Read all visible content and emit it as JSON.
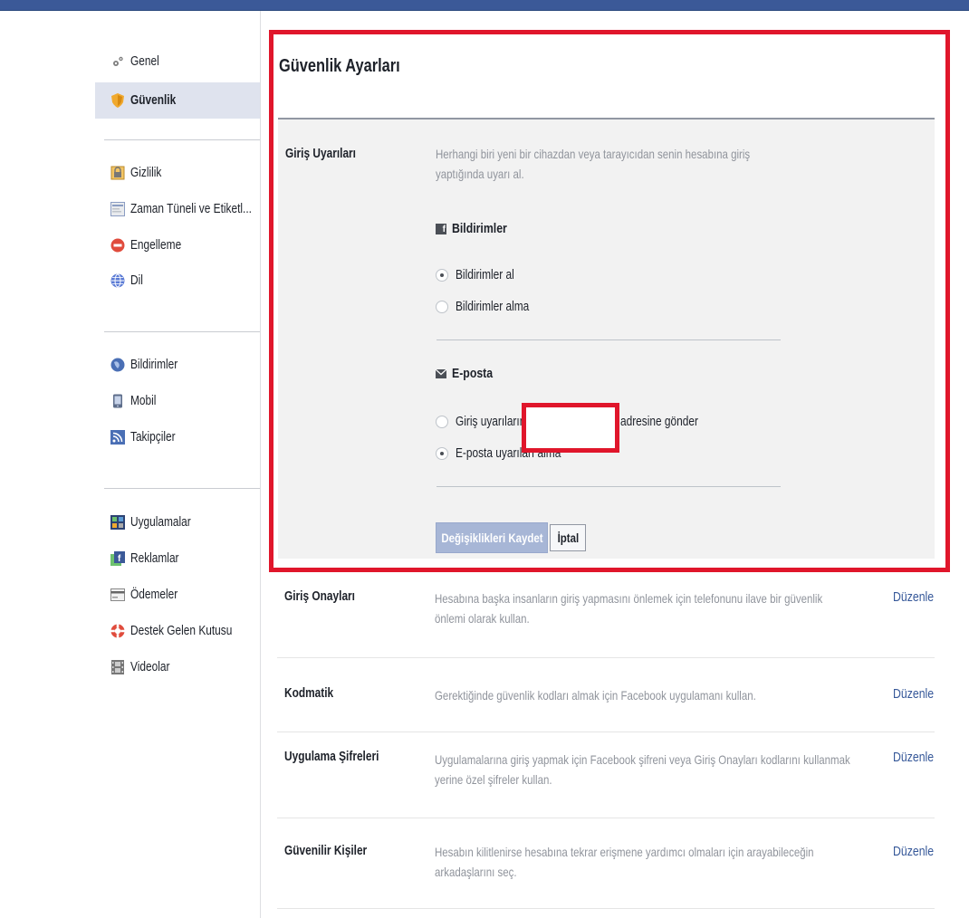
{
  "sidebar": {
    "groups": [
      [
        {
          "label": "Genel",
          "icon": "gear-icon"
        },
        {
          "label": "Güvenlik",
          "icon": "shield-icon",
          "active": true
        }
      ],
      [
        {
          "label": "Gizlilik",
          "icon": "lock-icon"
        },
        {
          "label": "Zaman Tüneli ve Etiketl...",
          "icon": "timeline-icon"
        },
        {
          "label": "Engelleme",
          "icon": "block-icon"
        },
        {
          "label": "Dil",
          "icon": "globe-icon"
        }
      ],
      [
        {
          "label": "Bildirimler",
          "icon": "notifications-globe-icon"
        },
        {
          "label": "Mobil",
          "icon": "phone-icon"
        },
        {
          "label": "Takipçiler",
          "icon": "rss-icon"
        }
      ],
      [
        {
          "label": "Uygulamalar",
          "icon": "apps-icon"
        },
        {
          "label": "Reklamlar",
          "icon": "ads-icon"
        },
        {
          "label": "Ödemeler",
          "icon": "credit-card-icon"
        },
        {
          "label": "Destek Gelen Kutusu",
          "icon": "lifebuoy-icon"
        },
        {
          "label": "Videolar",
          "icon": "film-icon"
        }
      ]
    ]
  },
  "main": {
    "title": "Güvenlik Ayarları",
    "login_alerts": {
      "label": "Giriş Uyarıları",
      "description": "Herhangi biri yeni bir cihazdan veya tarayıcıdan senin hesabına giriş yaptığında uyarı al.",
      "notifications_heading": "Bildirimler",
      "notifications_options": [
        "Bildirimler al",
        "Bildirimler alma"
      ],
      "email_heading": "E-posta",
      "email_option_send_prefix": "Giriş uyarılarını",
      "email_option_send_suffix": "adresine gönder",
      "email_option_none": "E-posta uyarıları alma",
      "save_label": "Değişiklikleri Kaydet",
      "cancel_label": "İptal"
    },
    "rows": [
      {
        "label": "Giriş Onayları",
        "description": "Hesabına başka insanların giriş yapmasını önlemek için telefonunu ilave bir güvenlik önlemi olarak kullan.",
        "action": "Düzenle"
      },
      {
        "label": "Kodmatik",
        "description": "Gerektiğinde güvenlik kodları almak için Facebook uygulamanı kullan.",
        "action": "Düzenle"
      },
      {
        "label": "Uygulama Şifreleri",
        "description": "Uygulamalarına giriş yapmak için Facebook şifreni veya Giriş Onayları kodlarını kullanmak yerine özel şifreler kullan.",
        "action": "Düzenle"
      },
      {
        "label": "Güvenilir Kişiler",
        "description": "Hesabın kilitlenirse hesabına tekrar erişmene yardımcı olmaları için arayabileceğin arkadaşlarını seç.",
        "action": "Düzenle"
      }
    ]
  },
  "colors": {
    "brand": "#3b5998",
    "link": "#365899",
    "highlight_frame": "#e0162b"
  }
}
